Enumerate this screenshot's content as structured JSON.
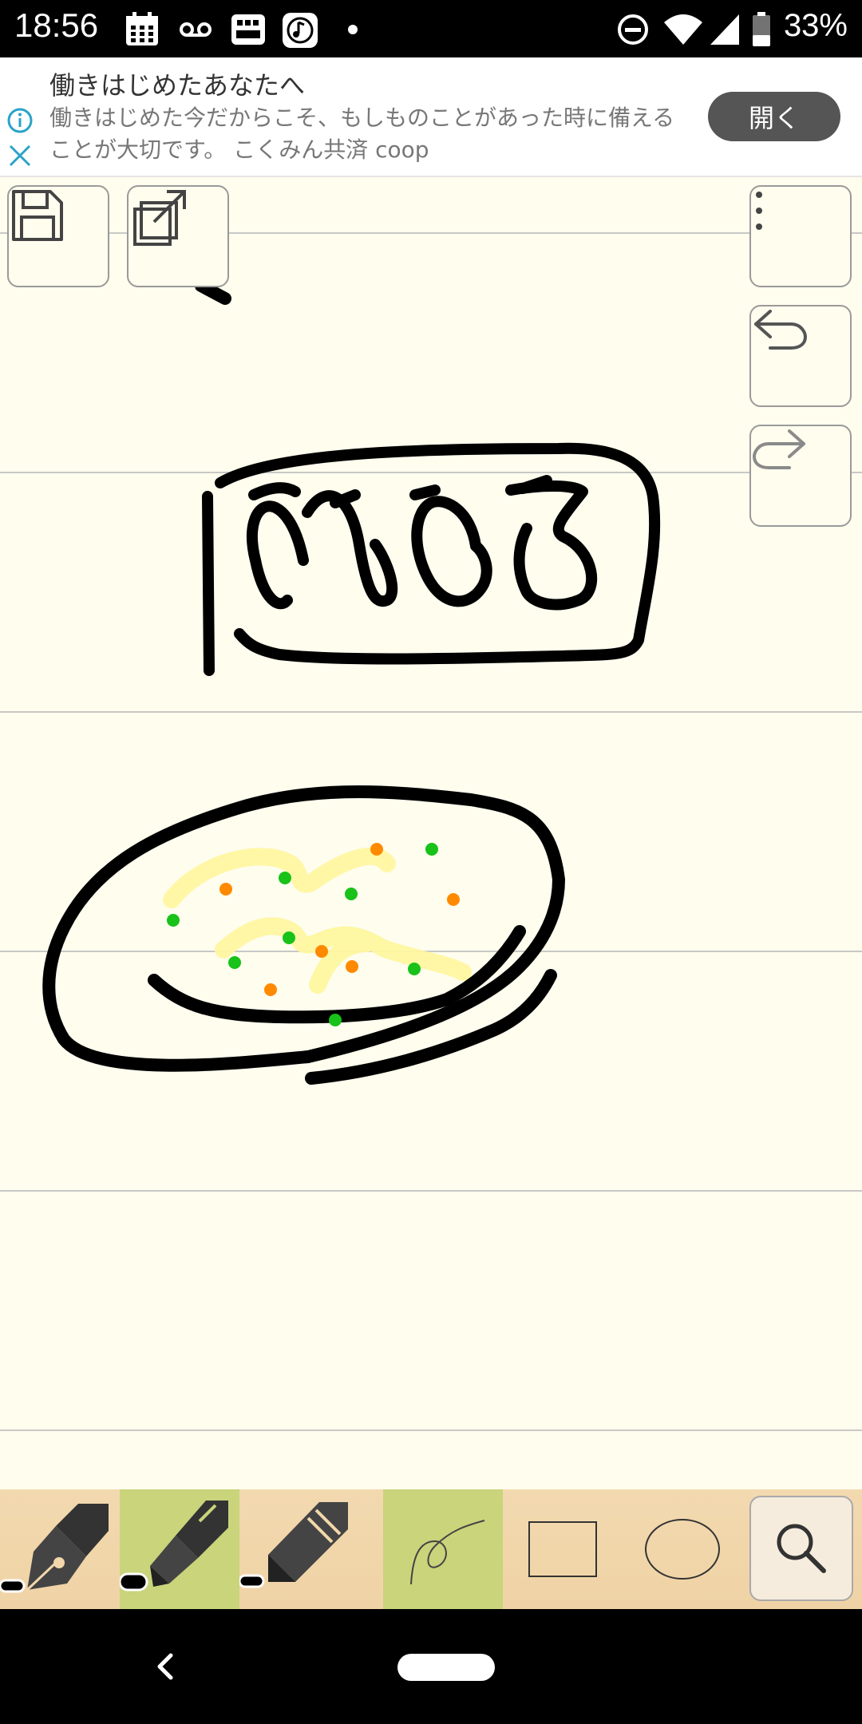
{
  "status_bar": {
    "time": "18:56",
    "battery_percent": "33%",
    "notification_icons": [
      "calendar-icon",
      "voicemail-icon",
      "rakuma-app-icon",
      "music-app-icon",
      "dot-icon"
    ],
    "system_icons": [
      "do-not-disturb-icon",
      "wifi-icon",
      "cellular-icon",
      "battery-icon"
    ]
  },
  "ad": {
    "title": "働きはじめたあなたへ",
    "description": "働きはじめた今だからこそ、もしものことがあった時に備えることが大切です。 こくみん共済 coop",
    "button_label": "開く"
  },
  "canvas_tools": {
    "top_left": [
      "save-icon",
      "share-export-icon"
    ],
    "top_right": [
      "more-menu-icon",
      "undo-icon",
      "redo-icon"
    ]
  },
  "toolbar": {
    "items": [
      "fountain-pen-tool",
      "marker-tool",
      "pencil-tool",
      "freehand-curve-tool",
      "rectangle-tool",
      "ellipse-tool",
      "zoom-search-tool"
    ],
    "active": [
      "marker-tool",
      "freehand-curve-tool"
    ]
  },
  "colors": {
    "canvas": "#fefdee",
    "ruled_line": "#c8c8c8",
    "active_tool": "#c9d47b",
    "orange_dot": "#ff8a00",
    "green_dot": "#18c218",
    "highlight": "#fff7a0"
  }
}
